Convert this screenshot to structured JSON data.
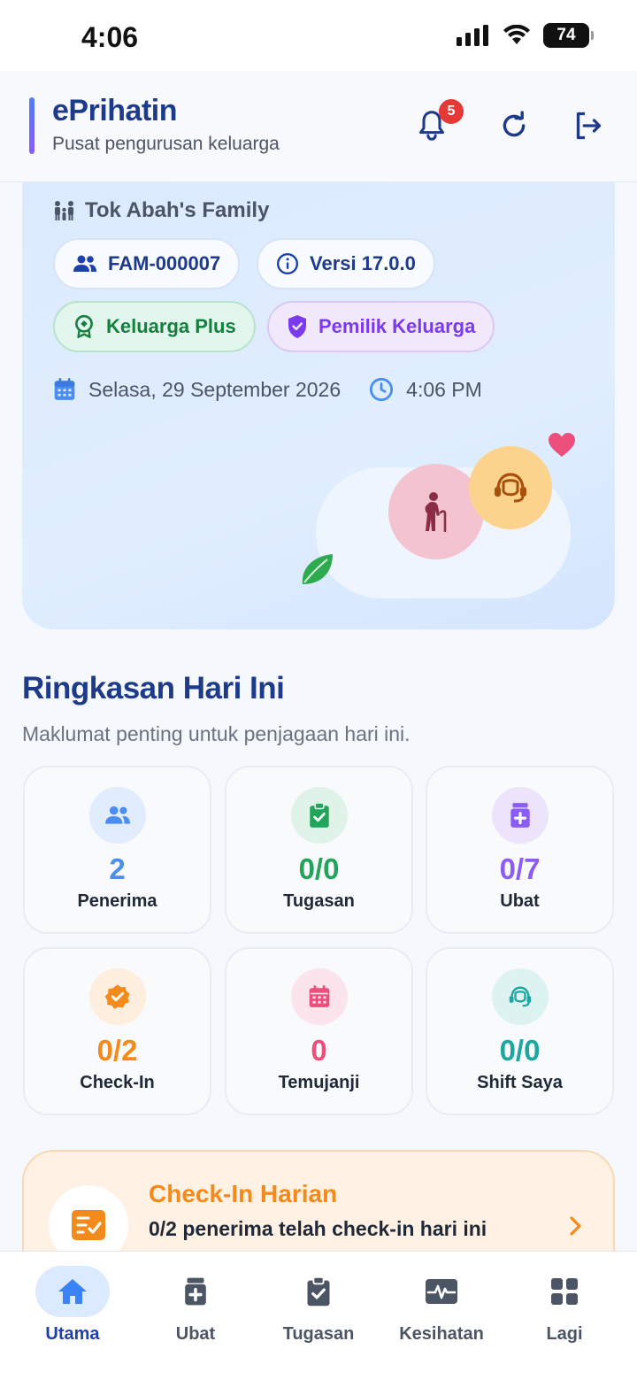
{
  "status_bar": {
    "time": "4:06",
    "battery": "74"
  },
  "header": {
    "title": "ePrihatin",
    "subtitle": "Pusat pengurusan keluarga",
    "notification_count": "5"
  },
  "hero": {
    "family_name": "Tok Abah's Family",
    "family_id": "FAM-000007",
    "version": "Versi 17.0.0",
    "plan": "Keluarga Plus",
    "role": "Pemilik Keluarga",
    "date": "Selasa, 29 September 2026",
    "time": "4:06 PM"
  },
  "summary": {
    "title": "Ringkasan Hari Ini",
    "subtitle": "Maklumat penting untuk penjagaan hari ini.",
    "stats": [
      {
        "value": "2",
        "label": "Penerima",
        "icon": "people-icon",
        "color": "#4a8ef0"
      },
      {
        "value": "0/0",
        "label": "Tugasan",
        "icon": "clipboard-check-icon",
        "color": "#22a55b"
      },
      {
        "value": "0/7",
        "label": "Ubat",
        "icon": "medicine-icon",
        "color": "#8b5cf6"
      },
      {
        "value": "0/2",
        "label": "Check-In",
        "icon": "verified-badge-icon",
        "color": "#f28a1c"
      },
      {
        "value": "0",
        "label": "Temujanji",
        "icon": "calendar-icon",
        "color": "#ec4f7b"
      },
      {
        "value": "0/0",
        "label": "Shift Saya",
        "icon": "headset-icon",
        "color": "#1fa6a0"
      }
    ]
  },
  "checkin": {
    "title": "Check-In Harian",
    "description": "0/2 penerima telah check-in hari ini"
  },
  "nav": {
    "items": [
      {
        "label": "Utama",
        "icon": "home-icon",
        "active": true
      },
      {
        "label": "Ubat",
        "icon": "medicine-icon"
      },
      {
        "label": "Tugasan",
        "icon": "clipboard-check-icon"
      },
      {
        "label": "Kesihatan",
        "icon": "heart-monitor-icon"
      },
      {
        "label": "Lagi",
        "icon": "grid-icon"
      }
    ]
  }
}
